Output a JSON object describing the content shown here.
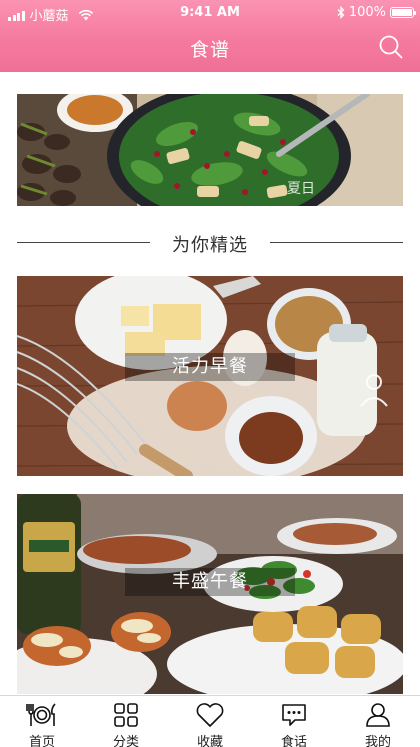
{
  "status_bar": {
    "carrier": "小蘑菇",
    "time": "9:41 AM",
    "battery": "100%"
  },
  "header": {
    "title": "食谱",
    "search_icon": "search-icon",
    "bg_color": "#f57aa0"
  },
  "banner": {
    "caption": "夏日"
  },
  "section": {
    "title": "为你精选"
  },
  "cards": [
    {
      "label": "活力早餐"
    },
    {
      "label": "丰盛午餐"
    }
  ],
  "tabbar": {
    "items": [
      {
        "label": "首页",
        "icon": "dining-icon"
      },
      {
        "label": "分类",
        "icon": "grid-icon"
      },
      {
        "label": "收藏",
        "icon": "heart-icon"
      },
      {
        "label": "食话",
        "icon": "chat-icon"
      },
      {
        "label": "我的",
        "icon": "user-icon"
      }
    ]
  }
}
